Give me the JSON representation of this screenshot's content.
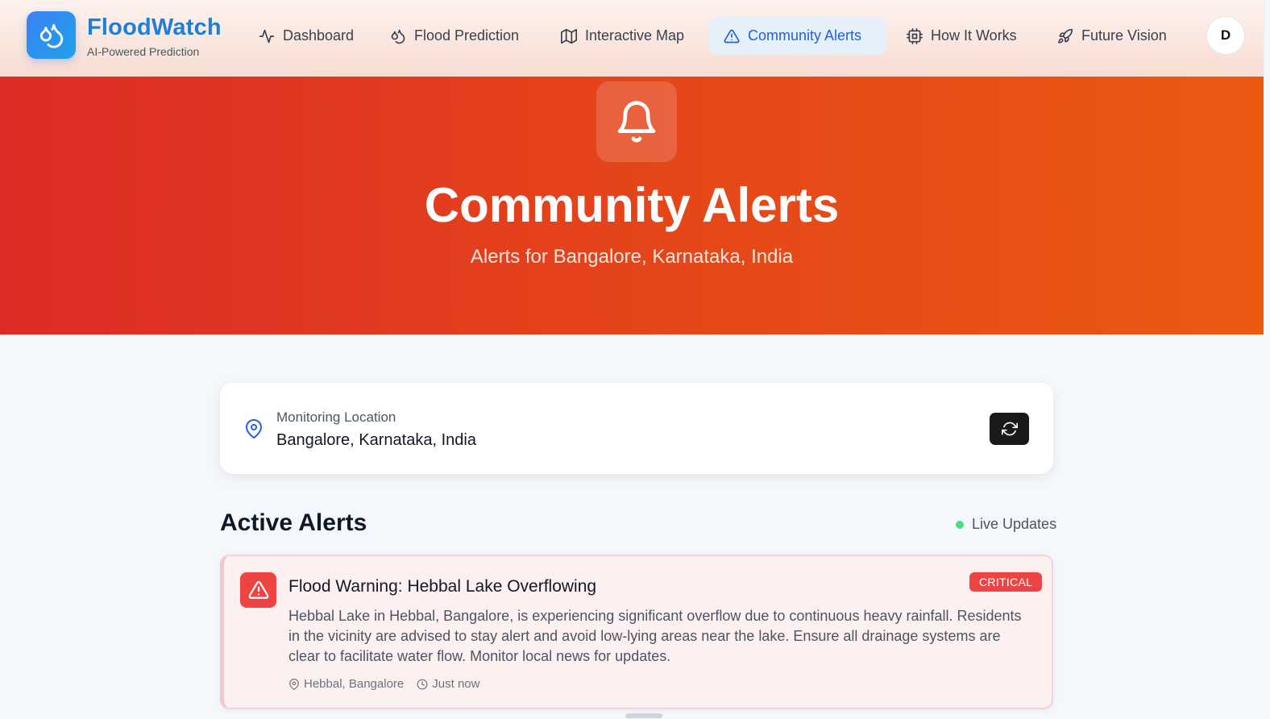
{
  "brand": {
    "name": "FloodWatch",
    "tagline": "AI-Powered Prediction",
    "icon": "droplets-icon"
  },
  "nav": {
    "items": [
      {
        "label": "Dashboard",
        "icon": "activity-icon"
      },
      {
        "label": "Flood Prediction",
        "icon": "droplets-icon"
      },
      {
        "label": "Interactive Map",
        "icon": "map-icon"
      },
      {
        "label": "Community Alerts",
        "icon": "alert-triangle-icon",
        "active": true
      },
      {
        "label": "How It Works",
        "icon": "cpu-icon"
      },
      {
        "label": "Future Vision",
        "icon": "rocket-icon"
      }
    ],
    "avatar_initial": "D"
  },
  "hero": {
    "icon": "bell-icon",
    "title": "Community Alerts",
    "subtitle": "Alerts for Bangalore, Karnataka, India"
  },
  "location": {
    "label": "Monitoring Location",
    "value": "Bangalore, Karnataka, India",
    "refresh_icon": "refresh-icon"
  },
  "alerts_section": {
    "title": "Active Alerts",
    "live_label": "Live Updates",
    "alerts": [
      {
        "title": "Flood Warning: Hebbal Lake Overflowing",
        "severity": "CRITICAL",
        "body": "Hebbal Lake in Hebbal, Bangalore, is experiencing significant overflow due to continuous heavy rainfall. Residents in the vicinity are advised to stay alert and avoid low-lying areas near the lake. Ensure all drainage systems are clear to facilitate water flow. Monitor local news for updates.",
        "location": "Hebbal, Bangalore",
        "time": "Just now"
      }
    ]
  },
  "colors": {
    "brand_blue": "#1e7fd6",
    "hero_start": "#de2b27",
    "hero_end": "#ea5a11",
    "critical": "#ef4444",
    "live": "#4ade80"
  }
}
